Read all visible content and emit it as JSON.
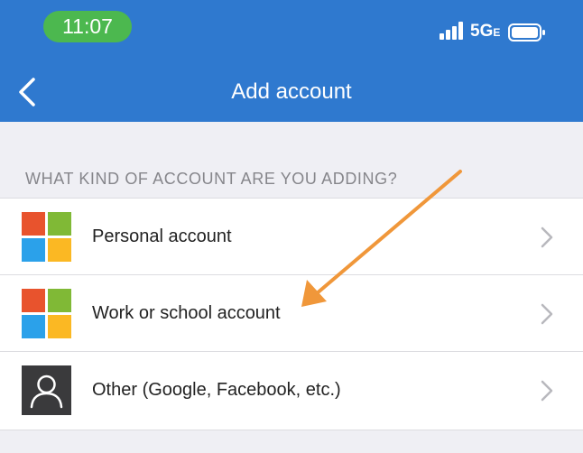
{
  "status_bar": {
    "time": "11:07",
    "network": "5G",
    "network_suffix": "E"
  },
  "header": {
    "title": "Add account",
    "back_icon": "chevron-left-icon"
  },
  "section": {
    "heading": "WHAT KIND OF ACCOUNT ARE YOU ADDING?"
  },
  "accounts": [
    {
      "label": "Personal account",
      "icon": "microsoft-logo-icon"
    },
    {
      "label": "Work or school account",
      "icon": "microsoft-logo-icon"
    },
    {
      "label": "Other (Google, Facebook, etc.)",
      "icon": "person-icon"
    }
  ],
  "colors": {
    "header": "#2f79cf",
    "time_pill": "#4cb84f",
    "annotation_arrow": "#f0973a",
    "ms_red": "#e8532d",
    "ms_green": "#80b936",
    "ms_blue": "#2ba1ea",
    "ms_yellow": "#fbb823"
  }
}
